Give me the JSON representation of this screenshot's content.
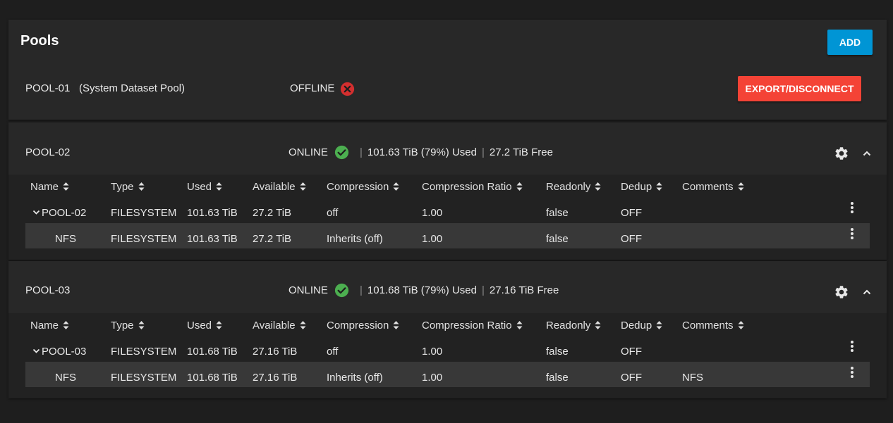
{
  "header": {
    "title": "Pools",
    "add_label": "ADD"
  },
  "colors": {
    "background": "#1e1e1e",
    "card": "#282828",
    "accent_blue": "#0095d5",
    "danger_red": "#f44336",
    "offline_icon": "#d32f2f",
    "online_icon": "#4caf50"
  },
  "pool1": {
    "name": "POOL-01",
    "note": "(System Dataset Pool)",
    "status": "OFFLINE",
    "status_icon": "close-circle-icon",
    "export_label": "EXPORT/DISCONNECT"
  },
  "columns": [
    "Name",
    "Type",
    "Used",
    "Available",
    "Compression",
    "Compression Ratio",
    "Readonly",
    "Dedup",
    "Comments"
  ],
  "pool2": {
    "name": "POOL-02",
    "status": "ONLINE",
    "status_icon": "check-circle-icon",
    "used_text": "101.63 TiB (79%) Used",
    "free_text": "27.2 TiB Free",
    "rows": [
      {
        "name": "POOL-02",
        "type": "FILESYSTEM",
        "used": "101.63 TiB",
        "available": "27.2 TiB",
        "compression": "off",
        "ratio": "1.00",
        "readonly": "false",
        "dedup": "OFF",
        "comments": ""
      },
      {
        "name": "NFS",
        "type": "FILESYSTEM",
        "used": "101.63 TiB",
        "available": "27.2 TiB",
        "compression": "Inherits (off)",
        "ratio": "1.00",
        "readonly": "false",
        "dedup": "OFF",
        "comments": ""
      }
    ]
  },
  "pool3": {
    "name": "POOL-03",
    "status": "ONLINE",
    "status_icon": "check-circle-icon",
    "used_text": "101.68 TiB (79%) Used",
    "free_text": "27.16 TiB Free",
    "rows": [
      {
        "name": "POOL-03",
        "type": "FILESYSTEM",
        "used": "101.68 TiB",
        "available": "27.16 TiB",
        "compression": "off",
        "ratio": "1.00",
        "readonly": "false",
        "dedup": "OFF",
        "comments": ""
      },
      {
        "name": "NFS",
        "type": "FILESYSTEM",
        "used": "101.68 TiB",
        "available": "27.16 TiB",
        "compression": "Inherits (off)",
        "ratio": "1.00",
        "readonly": "false",
        "dedup": "OFF",
        "comments": "NFS"
      }
    ]
  }
}
